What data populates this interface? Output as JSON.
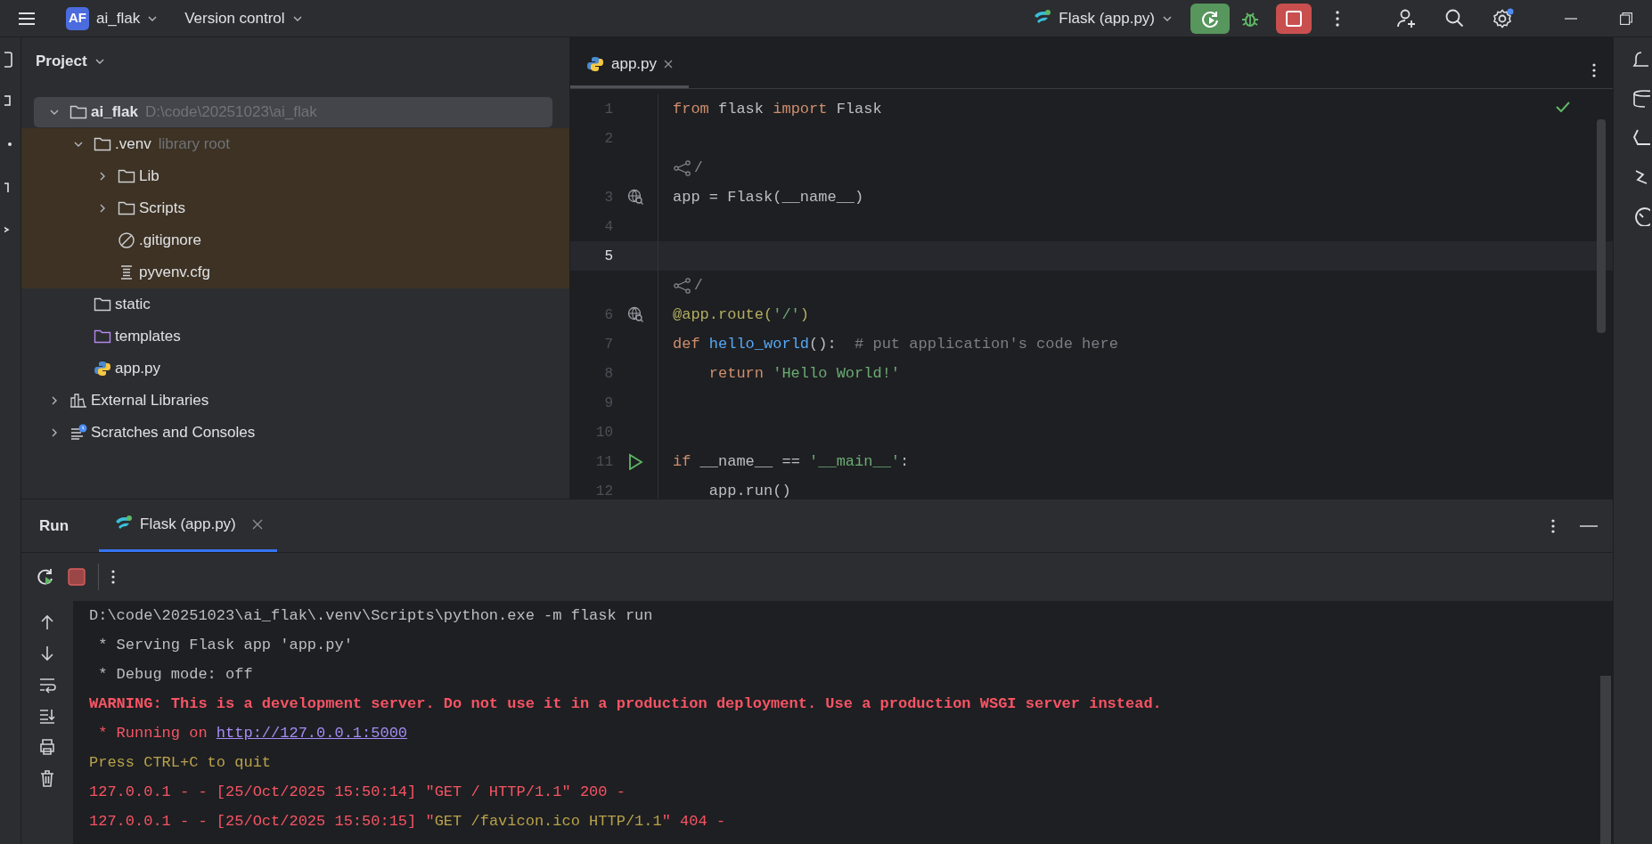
{
  "title_bar": {
    "project_badge": "AF",
    "project": "ai_flak",
    "vcs": "Version control",
    "run_config": "Flask (app.py)"
  },
  "project_panel": {
    "title": "Project",
    "tree": [
      {
        "label": "ai_flak",
        "hint": "D:\\code\\20251023\\ai_flak",
        "kind": "folder",
        "expanded": true,
        "selected": true,
        "children": [
          {
            "label": ".venv",
            "hint": "library root",
            "kind": "folder",
            "expanded": true,
            "selected": false,
            "library": true,
            "children": [
              {
                "label": "Lib",
                "kind": "folder",
                "expanded": false,
                "selected": false
              },
              {
                "label": "Scripts",
                "kind": "folder",
                "expanded": false,
                "selected": false
              },
              {
                "label": ".gitignore",
                "kind": "ignore",
                "selected": false
              },
              {
                "label": "pyvenv.cfg",
                "kind": "text",
                "selected": false
              }
            ]
          },
          {
            "label": "static",
            "kind": "folder",
            "selected": false
          },
          {
            "label": "templates",
            "kind": "folder-purple",
            "selected": false
          },
          {
            "label": "app.py",
            "kind": "python",
            "selected": false
          }
        ]
      },
      {
        "label": "External Libraries",
        "kind": "libraries",
        "expanded": false,
        "selected": false
      },
      {
        "label": "Scratches and Consoles",
        "kind": "scratches",
        "expanded": false,
        "selected": false
      }
    ]
  },
  "editor": {
    "tabs": [
      {
        "label": "app.py",
        "selected": true
      }
    ],
    "lines": [
      {
        "kind": "code",
        "number": "1",
        "current": false,
        "tokens": [
          {
            "text": "from ",
            "kind": "keyword"
          },
          {
            "text": "flask ",
            "kind": "plain"
          },
          {
            "text": "import ",
            "kind": "keyword"
          },
          {
            "text": "Flask",
            "kind": "plain"
          }
        ]
      },
      {
        "kind": "code",
        "number": "2",
        "current": false
      },
      {
        "kind": "lens",
        "text": "/"
      },
      {
        "kind": "code",
        "number": "3",
        "current": false,
        "gutter": {
          "kind": "globe"
        },
        "tokens": [
          {
            "text": "app = Flask(__name__)",
            "kind": "plain"
          }
        ]
      },
      {
        "kind": "code",
        "number": "4",
        "current": false
      },
      {
        "kind": "code",
        "number": "5",
        "current": true
      },
      {
        "kind": "lens",
        "text": "/"
      },
      {
        "kind": "code",
        "number": "6",
        "current": false,
        "gutter": {
          "kind": "globe"
        },
        "tokens": [
          {
            "text": "@app.route(",
            "kind": "decorator"
          },
          {
            "text": "'/'",
            "kind": "string"
          },
          {
            "text": ")",
            "kind": "decorator"
          }
        ]
      },
      {
        "kind": "code",
        "number": "7",
        "current": false,
        "tokens": [
          {
            "text": "def ",
            "kind": "keyword"
          },
          {
            "text": "hello_world",
            "kind": "function"
          },
          {
            "text": "():  ",
            "kind": "plain"
          },
          {
            "text": "# put application's code here",
            "kind": "comment"
          }
        ]
      },
      {
        "kind": "code",
        "number": "8",
        "current": false,
        "tokens": [
          {
            "text": "    return ",
            "kind": "keyword"
          },
          {
            "text": "'Hello World!'",
            "kind": "string"
          }
        ]
      },
      {
        "kind": "code",
        "number": "9",
        "current": false
      },
      {
        "kind": "code",
        "number": "10",
        "current": false
      },
      {
        "kind": "code",
        "number": "11",
        "current": false,
        "gutter": {
          "kind": "run"
        },
        "tokens": [
          {
            "text": "if ",
            "kind": "keyword"
          },
          {
            "text": "__name__ == ",
            "kind": "plain"
          },
          {
            "text": "'__main__'",
            "kind": "string"
          },
          {
            "text": ":",
            "kind": "plain"
          }
        ]
      },
      {
        "kind": "code",
        "number": "12",
        "current": false,
        "tokens": [
          {
            "text": "    app.run()",
            "kind": "plain"
          }
        ]
      }
    ]
  },
  "run_panel": {
    "title": "Run",
    "tabs": [
      {
        "label": "Flask (app.py)",
        "selected": true
      }
    ],
    "console": [
      [
        {
          "text": "D:\\code\\20251023\\ai_flak\\.venv\\Scripts\\python.exe -m flask run",
          "kind": "plain"
        }
      ],
      [
        {
          "text": " * Serving Flask app 'app.py'",
          "kind": "plain"
        }
      ],
      [
        {
          "text": " * Debug mode: off",
          "kind": "plain"
        }
      ],
      [
        {
          "text": "WARNING: This is a development server. Do not use it in a production deployment. Use a production WSGI server instead.",
          "kind": "error-bold"
        }
      ],
      [
        {
          "text": " * Running on ",
          "kind": "error"
        },
        {
          "text": "http://127.0.0.1:5000",
          "kind": "link"
        }
      ],
      [
        {
          "text": "Press CTRL+C to quit",
          "kind": "warning"
        }
      ],
      [
        {
          "text": "127.0.0.1 - - [25/Oct/2025 15:50:14] \"GET / HTTP/1.1\" 200 -",
          "kind": "error"
        }
      ],
      [
        {
          "text": "127.0.0.1 - - [25/Oct/2025 15:50:15] \"",
          "kind": "error"
        },
        {
          "text": "GET /favicon.ico HTTP/1.1",
          "kind": "warning"
        },
        {
          "text": "\" 404 -",
          "kind": "error"
        }
      ]
    ]
  }
}
